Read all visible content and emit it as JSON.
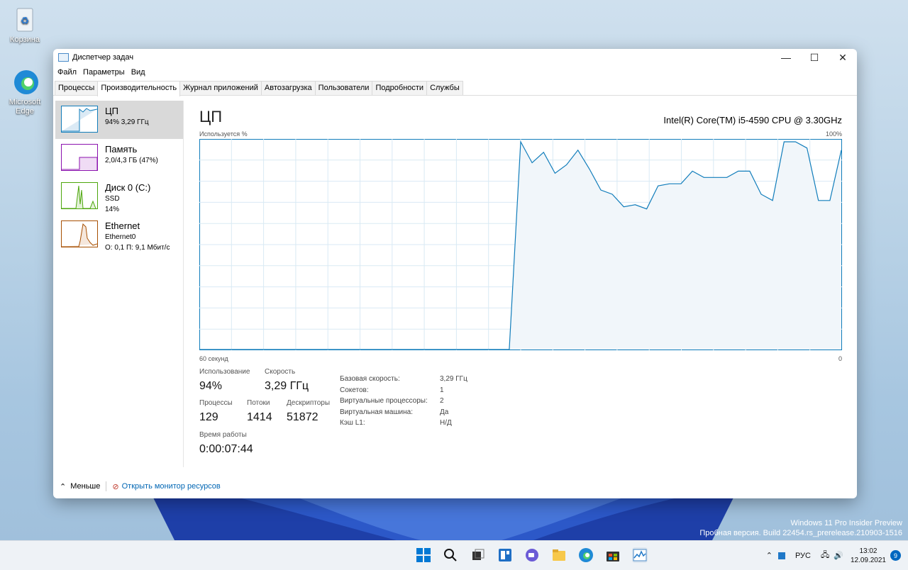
{
  "desktop": {
    "recycle_bin": "Корзина",
    "edge": "Microsoft Edge",
    "watermark_line1": "Windows 11 Pro Insider Preview",
    "watermark_line2": "Пробная версия. Build 22454.rs_prerelease.210903-1516"
  },
  "window": {
    "title": "Диспетчер задач",
    "menu": [
      "Файл",
      "Параметры",
      "Вид"
    ],
    "tabs": [
      "Процессы",
      "Производительность",
      "Журнал приложений",
      "Автозагрузка",
      "Пользователи",
      "Подробности",
      "Службы"
    ],
    "active_tab": 1
  },
  "resources": [
    {
      "name": "ЦП",
      "line2": "94% 3,29 ГГц",
      "line3": "",
      "color": "#117dbb"
    },
    {
      "name": "Память",
      "line2": "2,0/4,3 ГБ (47%)",
      "line3": "",
      "color": "#8b12ae"
    },
    {
      "name": "Диск 0 (C:)",
      "line2": "SSD",
      "line3": "14%",
      "color": "#4da60c"
    },
    {
      "name": "Ethernet",
      "line2": "Ethernet0",
      "line3": "О: 0,1 П: 9,1 Мбит/с",
      "color": "#a74f01"
    }
  ],
  "cpu": {
    "title": "ЦП",
    "model": "Intel(R) Core(TM) i5-4590 CPU @ 3.30GHz",
    "graph_label": "Используется %",
    "graph_max": "100%",
    "graph_time": "60 секунд",
    "graph_min": "0",
    "utilization_label": "Использование",
    "utilization": "94%",
    "speed_label": "Скорость",
    "speed": "3,29 ГГц",
    "processes_label": "Процессы",
    "processes": "129",
    "threads_label": "Потоки",
    "threads": "1414",
    "handles_label": "Дескрипторы",
    "handles": "51872",
    "uptime_label": "Время работы",
    "uptime": "0:00:07:44",
    "details": [
      {
        "k": "Базовая скорость:",
        "v": "3,29 ГГц"
      },
      {
        "k": "Сокетов:",
        "v": "1"
      },
      {
        "k": "Виртуальные процессоры:",
        "v": "2"
      },
      {
        "k": "Виртуальная машина:",
        "v": "Да"
      },
      {
        "k": "Кэш L1:",
        "v": "Н/Д"
      }
    ],
    "history_percent": [
      0,
      0,
      0,
      0,
      0,
      0,
      0,
      0,
      0,
      0,
      0,
      0,
      0,
      0,
      0,
      0,
      0,
      0,
      0,
      0,
      0,
      0,
      0,
      0,
      0,
      0,
      0,
      0,
      99,
      89,
      94,
      84,
      88,
      95,
      86,
      76,
      74,
      68,
      69,
      67,
      78,
      79,
      79,
      85,
      82,
      82,
      82,
      85,
      85,
      74,
      71,
      99,
      99,
      96,
      71,
      71,
      95
    ]
  },
  "footer": {
    "less": "Меньше",
    "monitor": "Открыть монитор ресурсов"
  },
  "tray": {
    "lang": "РУС",
    "time": "13:02",
    "date": "12.09.2021",
    "notifications": "9"
  }
}
